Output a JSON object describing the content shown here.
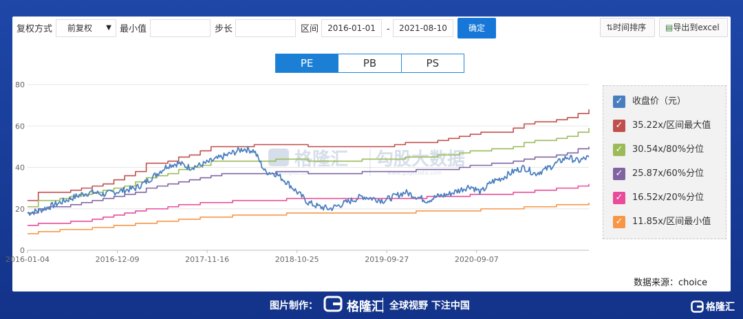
{
  "toolbar": {
    "adjust_label": "复权方式",
    "adjust_value": "前复权",
    "min_label": "最小值",
    "min_value": "",
    "step_label": "步长",
    "step_value": "",
    "range_label": "区间",
    "start_date": "2016-01-01",
    "dash": "-",
    "end_date": "2021-08-10",
    "confirm": "确定",
    "sort_label": "时间排序",
    "export_label": "导出到excel"
  },
  "tabs": [
    {
      "label": "PE",
      "active": true
    },
    {
      "label": "PB",
      "active": false
    },
    {
      "label": "PS",
      "active": false
    }
  ],
  "watermark": {
    "brand": "格隆汇",
    "sub": "gelonghui.com",
    "text2": "勾股大数据",
    "url2": "www.gogudata.com"
  },
  "source": "数据来源：choice",
  "footer": {
    "made_by": "图片制作：",
    "brand": "格隆汇",
    "slogan": "全球视野 下注中国",
    "corner_brand": "格隆汇"
  },
  "chart_data": {
    "type": "line",
    "ylim": [
      0,
      80
    ],
    "yticks": [
      0,
      20,
      40,
      60,
      80
    ],
    "xtick_labels": [
      "2016-01-04",
      "2016-12-09",
      "2017-11-16",
      "2018-10-25",
      "2019-09-27",
      "2020-09-07"
    ],
    "legend_position": "right",
    "series": [
      {
        "name": "收盘价（元）",
        "color": "#4a7fbf",
        "style": "noisy",
        "values": [
          18,
          19,
          21,
          23,
          25,
          27,
          28,
          27,
          28,
          29,
          30,
          33,
          37,
          41,
          42,
          40,
          41,
          43,
          45,
          47,
          49,
          48,
          38,
          37,
          33,
          28,
          23,
          21,
          20,
          22,
          24,
          26,
          25,
          24,
          26,
          28,
          26,
          24,
          26,
          27,
          29,
          31,
          28,
          33,
          35,
          38,
          40,
          37,
          39,
          42,
          45,
          43,
          45
        ]
      },
      {
        "name": "35.22x/区间最大值",
        "color": "#c0504d",
        "style": "step",
        "values": [
          24,
          28,
          28,
          28,
          29,
          30,
          31,
          32,
          34,
          36,
          38,
          42,
          42,
          43,
          45,
          46,
          48,
          50,
          50,
          50,
          50,
          51,
          51,
          51,
          51,
          51,
          50,
          50,
          50,
          50,
          50,
          50,
          50,
          50,
          51,
          52,
          52,
          52,
          53,
          54,
          55,
          56,
          57,
          57,
          57,
          59,
          61,
          62,
          62,
          63,
          64,
          66,
          68
        ]
      },
      {
        "name": "30.54x/80%分位",
        "color": "#9bbb59",
        "style": "step",
        "values": [
          21,
          24,
          24,
          25,
          26,
          27,
          28,
          29,
          30,
          31,
          33,
          35,
          36,
          37,
          39,
          40,
          41,
          43,
          43,
          43,
          43,
          43,
          43,
          44,
          44,
          44,
          43,
          43,
          43,
          43,
          43,
          44,
          44,
          44,
          44,
          45,
          45,
          45,
          46,
          46,
          47,
          48,
          48,
          49,
          49,
          50,
          52,
          53,
          53,
          54,
          55,
          57,
          59
        ]
      },
      {
        "name": "25.87x/60%分位",
        "color": "#8064a2",
        "style": "step",
        "values": [
          18,
          20,
          21,
          21,
          22,
          23,
          24,
          25,
          26,
          27,
          28,
          30,
          31,
          32,
          33,
          34,
          35,
          36,
          37,
          37,
          37,
          37,
          37,
          38,
          38,
          38,
          37,
          37,
          37,
          37,
          37,
          38,
          38,
          38,
          38,
          38,
          39,
          39,
          39,
          39,
          40,
          41,
          41,
          42,
          42,
          43,
          44,
          45,
          45,
          46,
          47,
          49,
          50
        ]
      },
      {
        "name": "16.52x/20%分位",
        "color": "#e84c9a",
        "style": "step",
        "values": [
          12,
          13,
          13,
          13,
          14,
          14,
          15,
          16,
          17,
          18,
          19,
          20,
          20,
          21,
          22,
          22,
          23,
          23,
          23,
          24,
          24,
          24,
          24,
          24,
          25,
          25,
          25,
          25,
          25,
          25,
          25,
          25,
          25,
          25,
          25,
          25,
          25,
          26,
          26,
          26,
          26,
          27,
          27,
          27,
          27,
          28,
          28,
          29,
          29,
          30,
          30,
          31,
          32
        ]
      },
      {
        "name": "11.85x/区间最小值",
        "color": "#f79646",
        "style": "step",
        "values": [
          8,
          9,
          9,
          10,
          10,
          10,
          11,
          11,
          12,
          12,
          13,
          13,
          14,
          14,
          15,
          15,
          16,
          16,
          16,
          17,
          17,
          17,
          17,
          17,
          18,
          18,
          18,
          18,
          18,
          18,
          18,
          18,
          18,
          18,
          18,
          18,
          19,
          19,
          19,
          19,
          19,
          19,
          20,
          20,
          20,
          20,
          21,
          21,
          21,
          22,
          22,
          22,
          23
        ]
      }
    ]
  }
}
